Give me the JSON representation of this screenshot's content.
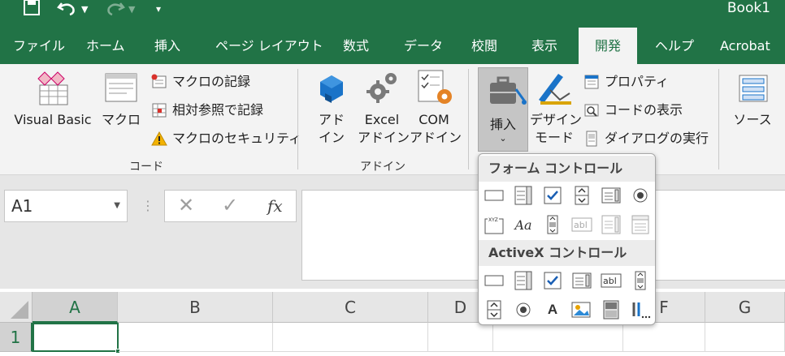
{
  "title_bar": {
    "document_title": "Book1"
  },
  "tabs": [
    {
      "label": "ファイル"
    },
    {
      "label": "ホーム"
    },
    {
      "label": "挿入"
    },
    {
      "label": "ページ レイアウト"
    },
    {
      "label": "数式"
    },
    {
      "label": "データ"
    },
    {
      "label": "校閲"
    },
    {
      "label": "表示"
    },
    {
      "label": "開発"
    },
    {
      "label": "ヘルプ"
    },
    {
      "label": "Acrobat"
    }
  ],
  "ribbon": {
    "code_group": {
      "label": "コード",
      "visual_basic": "Visual Basic",
      "macro": "マクロ",
      "record_macro": "マクロの記録",
      "relative_ref": "相対参照で記録",
      "macro_security": "マクロのセキュリティ"
    },
    "addins_group": {
      "label": "アドイン",
      "addin_line1": "アド",
      "addin_line2": "イン",
      "excel_line1": "Excel",
      "excel_line2": "アドイン",
      "com_line1": "COM",
      "com_line2": "アドイン"
    },
    "controls_group": {
      "insert": "挿入",
      "design_line1": "デザイン",
      "design_line2": "モード",
      "properties": "プロパティ",
      "view_code": "コードの表示",
      "run_dialog": "ダイアログの実行"
    },
    "xml_group": {
      "source": "ソース"
    }
  },
  "formula_bar": {
    "name_box": "A1",
    "fx": "fx"
  },
  "grid": {
    "columns": [
      "A",
      "B",
      "C",
      "D",
      "F",
      "G"
    ],
    "rows": [
      "1"
    ]
  },
  "insert_dropdown": {
    "form_controls_header": "フォーム コントロール",
    "activex_controls_header": "ActiveX コントロール",
    "activex_label_glyph": "A",
    "form_label_glyph": "Aa"
  },
  "colors": {
    "accent": "#217346",
    "ribbon": "#f3f3f3",
    "background": "#e6e6e6"
  }
}
